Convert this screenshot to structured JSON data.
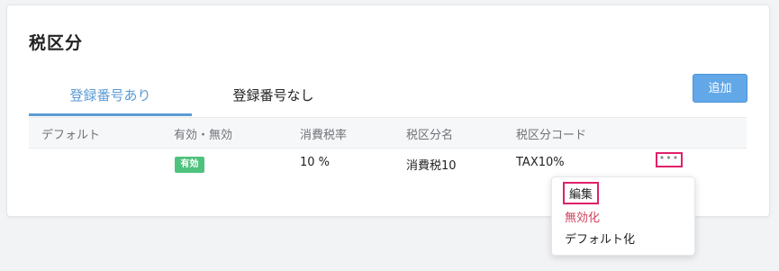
{
  "page": {
    "title": "税区分"
  },
  "tabs": [
    {
      "label": "登録番号あり",
      "active": true
    },
    {
      "label": "登録番号なし",
      "active": false
    }
  ],
  "toolbar": {
    "add_label": "追加"
  },
  "table": {
    "headers": [
      "デフォルト",
      "有効・無効",
      "消費税率",
      "税区分名",
      "税区分コード"
    ],
    "rows": [
      {
        "default": "",
        "status": "有効",
        "rate": "10 %",
        "name": "消費税10",
        "code": "TAX10%"
      }
    ]
  },
  "row_actions": {
    "more_label": "•••"
  },
  "menu": {
    "edit": "編集",
    "disable": "無効化",
    "set_default": "デフォルト化"
  },
  "colors": {
    "accent": "#5b9bd5",
    "button": "#62a8e8",
    "badge": "#4fc37d",
    "danger": "#d0425b",
    "highlight": "#e0206a"
  }
}
